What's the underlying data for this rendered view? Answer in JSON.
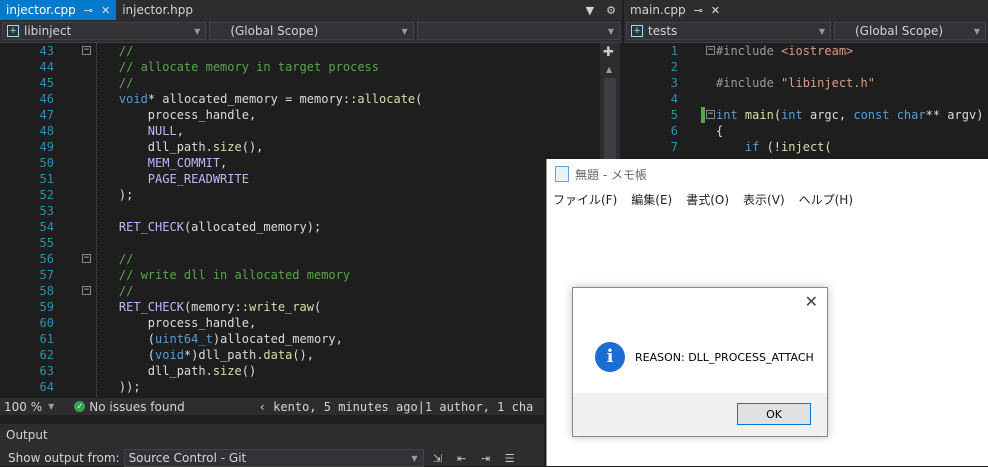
{
  "left_tabs": [
    {
      "label": "injector.cpp",
      "active": true
    },
    {
      "label": "injector.hpp",
      "active": false
    }
  ],
  "right_tabs": [
    {
      "label": "main.cpp"
    }
  ],
  "left_nav": {
    "project": "libinject",
    "scope": "(Global Scope)",
    "member": ""
  },
  "right_nav": {
    "project": "tests",
    "scope": "(Global Scope)"
  },
  "left_code": [
    {
      "n": "43",
      "t": "    //"
    },
    {
      "n": "44",
      "t": "    // allocate memory in target process"
    },
    {
      "n": "45",
      "t": "    //"
    },
    {
      "n": "46",
      "t": "    void* allocated_memory = memory::allocate("
    },
    {
      "n": "47",
      "t": "        process_handle,"
    },
    {
      "n": "48",
      "t": "        NULL,"
    },
    {
      "n": "49",
      "t": "        dll_path.size(),"
    },
    {
      "n": "50",
      "t": "        MEM_COMMIT,"
    },
    {
      "n": "51",
      "t": "        PAGE_READWRITE"
    },
    {
      "n": "52",
      "t": "    );"
    },
    {
      "n": "53",
      "t": ""
    },
    {
      "n": "54",
      "t": "    RET_CHECK(allocated_memory);"
    },
    {
      "n": "55",
      "t": ""
    },
    {
      "n": "56",
      "t": "    //"
    },
    {
      "n": "57",
      "t": "    // write dll in allocated memory"
    },
    {
      "n": "58",
      "t": "    //"
    },
    {
      "n": "59",
      "t": "    RET_CHECK(memory::write_raw("
    },
    {
      "n": "60",
      "t": "        process_handle,"
    },
    {
      "n": "61",
      "t": "        (uint64_t)allocated_memory,"
    },
    {
      "n": "62",
      "t": "        (void*)dll_path.data(),"
    },
    {
      "n": "63",
      "t": "        dll_path.size()"
    },
    {
      "n": "64",
      "t": "    ));"
    }
  ],
  "right_code": [
    {
      "n": "1",
      "t": "#include <iostream>"
    },
    {
      "n": "2",
      "t": ""
    },
    {
      "n": "3",
      "t": "#include \"libinject.h\""
    },
    {
      "n": "4",
      "t": ""
    },
    {
      "n": "5",
      "t": "int main(int argc, const char** argv)"
    },
    {
      "n": "6",
      "t": "{"
    },
    {
      "n": "7",
      "t": "    if (!inject("
    }
  ],
  "status": {
    "zoom": "100 %",
    "issues": "No issues found",
    "blame": "kento, 5 minutes ago",
    "authors": "1 author, 1 cha"
  },
  "output": {
    "title": "Output",
    "show_from_label": "Show output from:",
    "source": "Source Control - Git"
  },
  "notepad": {
    "title": "無題 - メモ帳",
    "menu": [
      "ファイル(F)",
      "編集(E)",
      "書式(O)",
      "表示(V)",
      "ヘルプ(H)"
    ]
  },
  "dialog": {
    "message": "REASON: DLL_PROCESS_ATTACH",
    "ok_label": "OK",
    "info_glyph": "i",
    "close_glyph": "✕"
  },
  "colors": {
    "accent": "#007acc",
    "comment": "#57a64a",
    "keyword": "#569cd6",
    "function": "#dcdcaa",
    "macro": "#beb7ff",
    "type": "#4ec9b0",
    "string": "#d69d85"
  }
}
